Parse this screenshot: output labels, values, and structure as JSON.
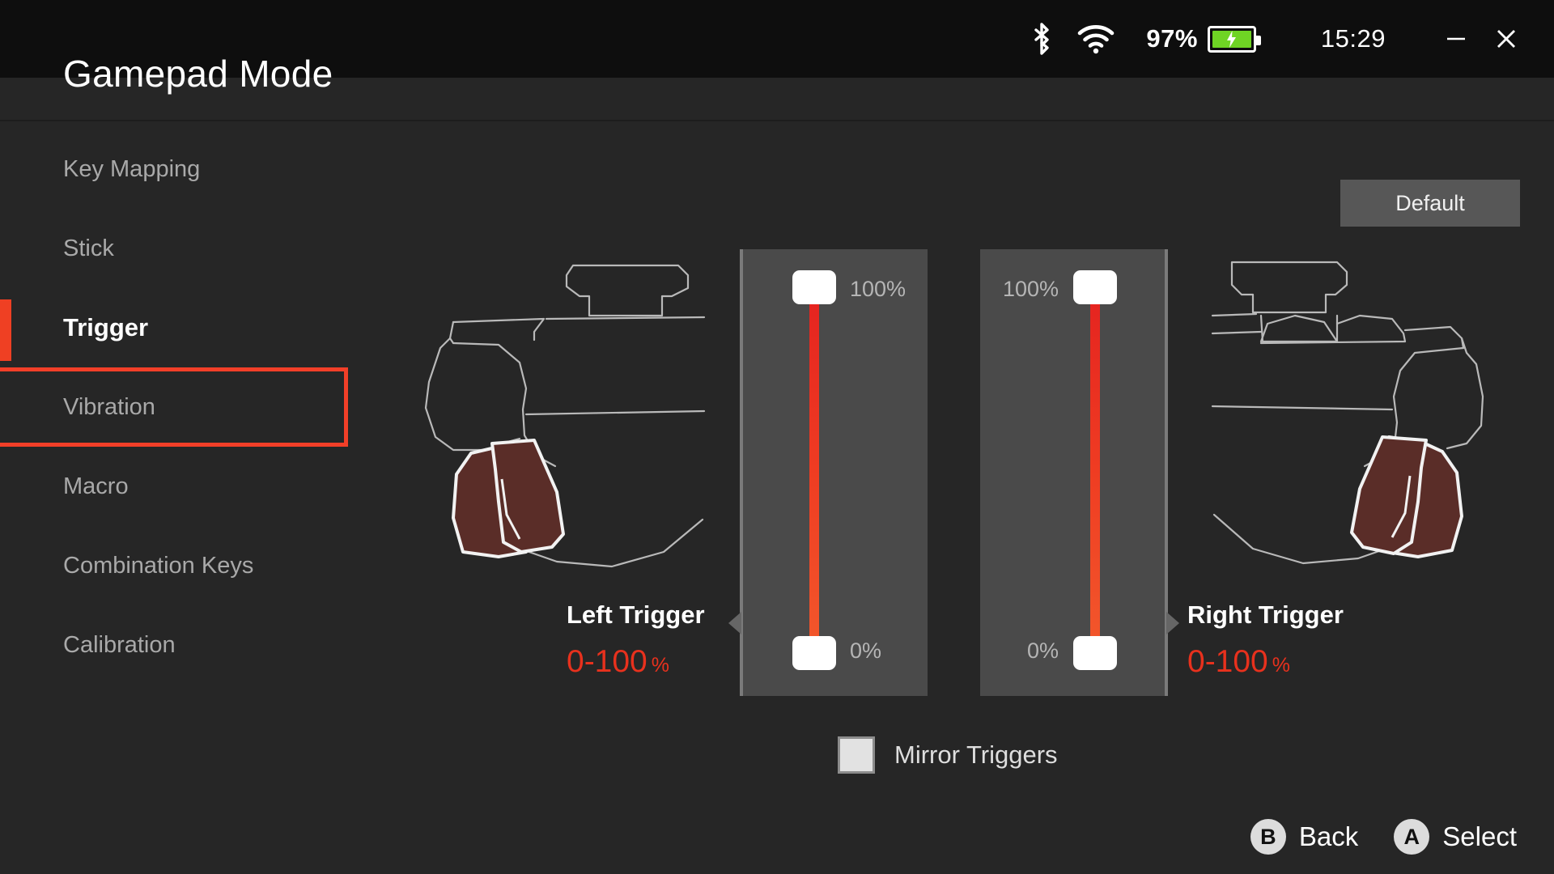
{
  "window": {
    "title": "Gamepad Mode",
    "minimize_label": "–",
    "close_label": "✕"
  },
  "statusbar": {
    "bluetooth_icon": "bluetooth-icon",
    "wifi_icon": "wifi-icon",
    "battery_percent": "97%",
    "battery_icon": "battery-charging-icon",
    "clock": "15:29"
  },
  "sidebar": {
    "items": [
      {
        "label": "Key Mapping",
        "state": "normal"
      },
      {
        "label": "Stick",
        "state": "normal"
      },
      {
        "label": "Trigger",
        "state": "active"
      },
      {
        "label": "Vibration",
        "state": "focused"
      },
      {
        "label": "Macro",
        "state": "normal"
      },
      {
        "label": "Combination Keys",
        "state": "normal"
      },
      {
        "label": "Calibration",
        "state": "normal"
      }
    ]
  },
  "toolbar": {
    "default_label": "Default"
  },
  "triggers": {
    "left": {
      "name": "Left Trigger",
      "range": "0-100",
      "unit": "%",
      "max_label": "100%",
      "min_label": "0%",
      "art_name": "left-trigger-controller-illustration"
    },
    "right": {
      "name": "Right Trigger",
      "range": "0-100",
      "unit": "%",
      "max_label": "100%",
      "min_label": "0%",
      "art_name": "right-trigger-controller-illustration"
    }
  },
  "mirror": {
    "label": "Mirror Triggers",
    "checked": false
  },
  "hints": [
    {
      "button": "B",
      "label": "Back"
    },
    {
      "button": "A",
      "label": "Select"
    }
  ],
  "colors": {
    "accent_red": "#ef4023",
    "focus_red": "#f23f28",
    "value_red": "#e8311d",
    "panel_gray": "#4a4a4a",
    "button_gray": "#575757",
    "background": "#262626",
    "statusbar": "#0e0e0e",
    "battery_green": "#6fd424",
    "trigger_fill": "#5a2d28"
  }
}
